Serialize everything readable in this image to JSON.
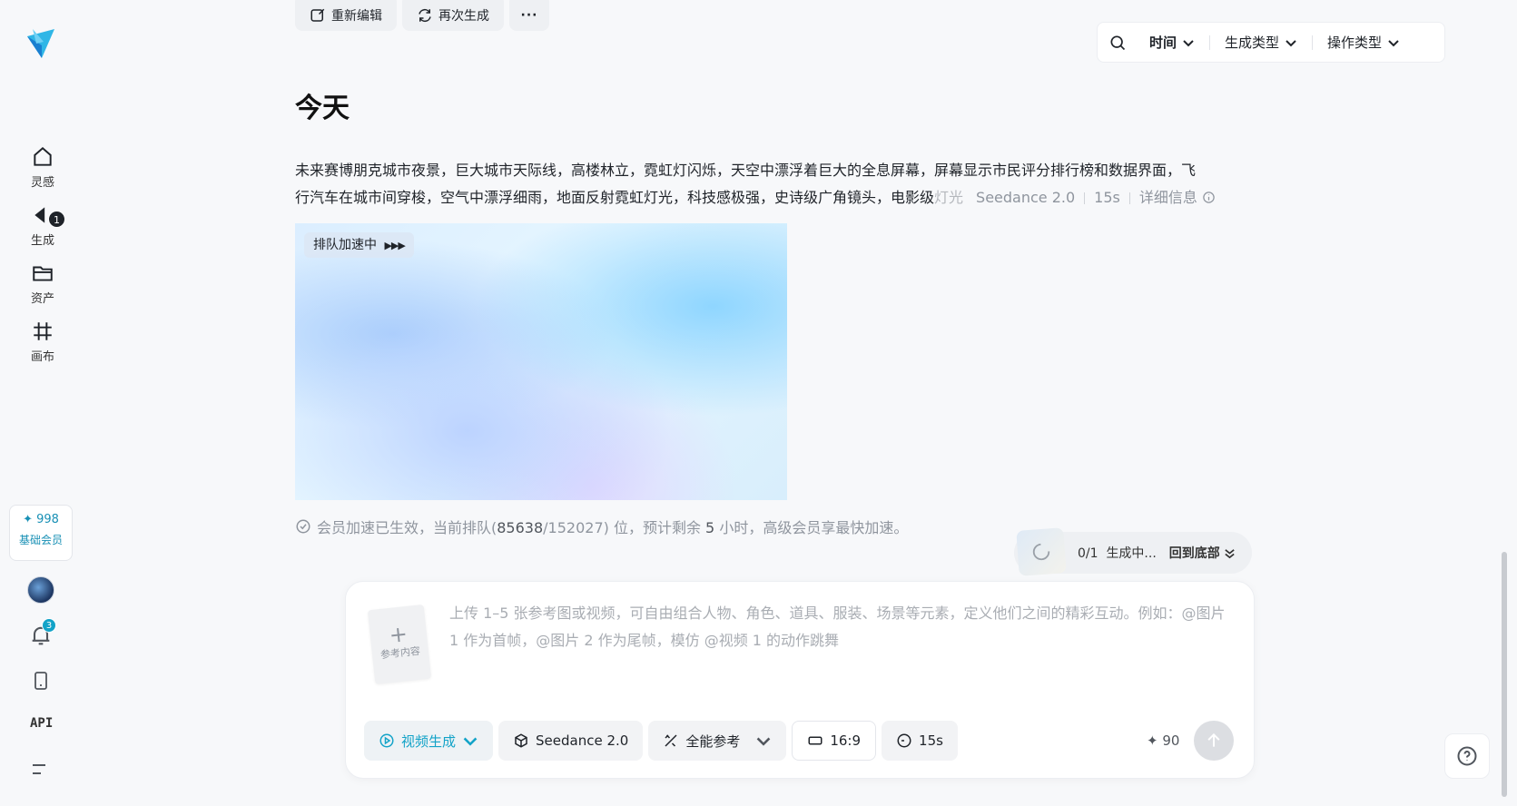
{
  "sidebar": {
    "nav": [
      {
        "label": "灵感"
      },
      {
        "label": "生成",
        "badge": "1"
      },
      {
        "label": "资产"
      },
      {
        "label": "画布"
      }
    ],
    "credits": "998",
    "membership": "基础会员",
    "notifications_badge": "3",
    "api_label": "API"
  },
  "toolbar": {
    "reedit": "重新编辑",
    "regenerate": "再次生成",
    "more": "···"
  },
  "filters": {
    "time": "时间",
    "gen_type": "生成类型",
    "op_type": "操作类型"
  },
  "section_title": "今天",
  "task": {
    "prompt_line1": "未来赛博朋克城市夜景，巨大城市天际线，高楼林立，霓虹灯闪烁，天空中漂浮着巨大的全息屏幕，屏幕显示市民评分排行榜和数据界面，飞",
    "prompt_line2": "行汽车在城市间穿梭，空气中漂浮细雨，地面反射霓虹灯光，科技感极强，史诗级广角镜头，电影级",
    "prompt_fade": "灯光",
    "model": "Seedance 2.0",
    "duration": "15s",
    "details": "详细信息",
    "queue_tag": "排队加速中",
    "status_prefix": "会员加速已生效，当前排队(",
    "queue_position": "85638",
    "queue_total": "/152027",
    "status_mid": ") 位，预计剩余 ",
    "hours": "5",
    "status_suffix": " 小时，高级会员享最快加速。"
  },
  "progress": {
    "count": "0/1",
    "state": "生成中...",
    "back_to_bottom": "回到底部"
  },
  "composer": {
    "ref_label": "参考内容",
    "placeholder": "上传 1–5 张参考图或视频，可自由组合人物、角色、道具、服装、场景等元素，定义他们之间的精彩互动。例如：@图片 1 作为首帧，@图片 2 作为尾帧，模仿 @视频 1 的动作跳舞",
    "mode": "视频生成",
    "model": "Seedance 2.0",
    "reference": "全能参考",
    "ratio": "16:9",
    "duration": "15s",
    "cost": "90"
  },
  "colors": {
    "accent": "#13a3c8",
    "bg": "#f7f8fa"
  }
}
